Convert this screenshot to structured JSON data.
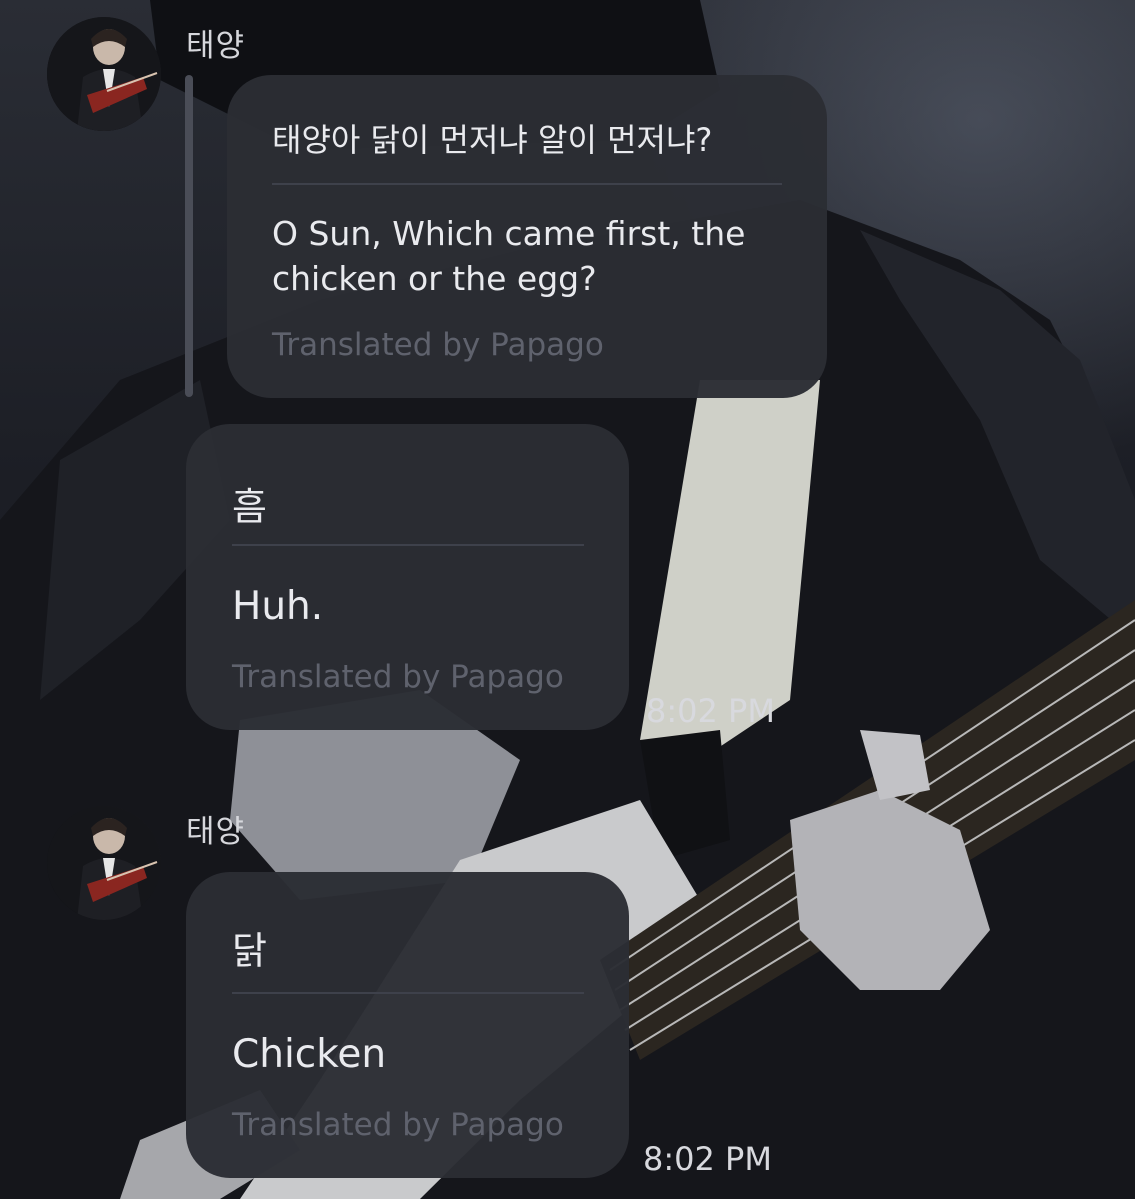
{
  "colors": {
    "bubble": "#2b2d34",
    "text": "#e9eaee",
    "credit": "#5f626d",
    "divider": "#3e414b"
  },
  "messages": [
    {
      "sender": "태양",
      "original": "태양아 닭이 먼저냐 알이 먼저냐?",
      "translation": "O Sun, Which came first, the chicken or the egg?",
      "credit": "Translated by Papago",
      "quoted": true
    },
    {
      "original": "흠",
      "translation": "Huh.",
      "credit": "Translated by Papago",
      "time": "8:02 PM"
    },
    {
      "sender": "태양",
      "original": "닭",
      "translation": "Chicken",
      "credit": "Translated by Papago",
      "time": "8:02 PM"
    }
  ]
}
